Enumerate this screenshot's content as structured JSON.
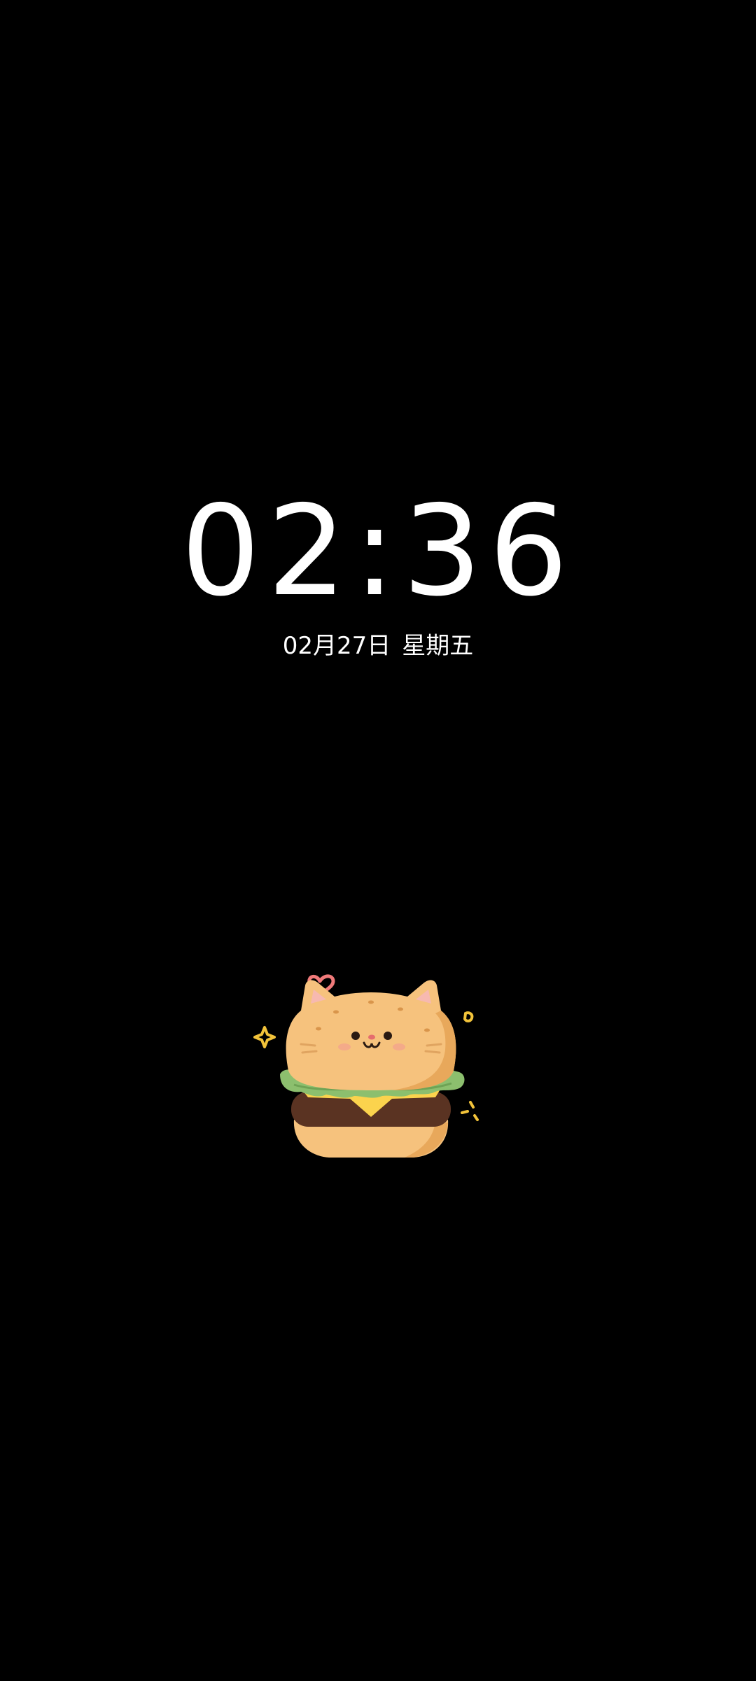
{
  "lockscreen": {
    "time": "02:36",
    "date": "02月27日",
    "weekday": "星期五"
  },
  "wallpaper": {
    "sticker": "cat-burger-icon",
    "background_color": "#000000",
    "colors": {
      "bun": "#F6C27D",
      "bun_shade": "#E8A85B",
      "lettuce": "#8CBF6E",
      "patty": "#5A3322",
      "cheese": "#FBD34D",
      "heart": "#F07A7A",
      "sparkle": "#F2C33A"
    }
  }
}
